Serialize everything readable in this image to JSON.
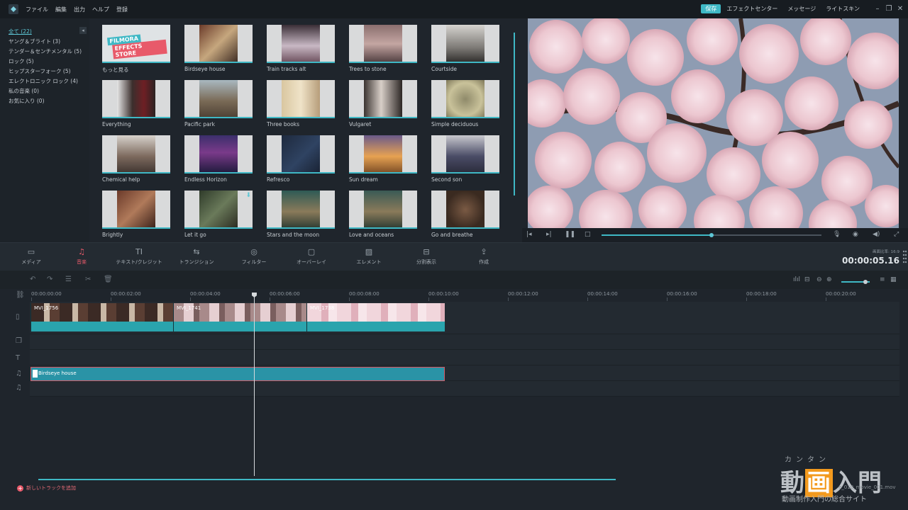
{
  "menubar": {
    "items": [
      "ファイル",
      "編集",
      "出力",
      "ヘルプ",
      "登録"
    ],
    "save_label": "保存",
    "links": [
      "エフェクトセンター",
      "メッセージ",
      "ライトスキン"
    ]
  },
  "sidebar": {
    "categories": [
      "全て (22)",
      "ヤング＆ブライト (3)",
      "テンダー＆センチメンタル (5)",
      "ロック (5)",
      "ヒップスターフォーク (5)",
      "エレクトロニック ロック (4)",
      "私の音楽 (0)",
      "お気に入り (0)"
    ]
  },
  "grid": {
    "store": {
      "line1": "FILMORA",
      "line2": "EFFECTS STORE",
      "label": "もっと見る"
    },
    "tiles": [
      "Birdseye house",
      "Train tracks alt",
      "Trees to stone",
      "Courtside",
      "Everything",
      "Pacific park",
      "Three books",
      "Vulgaret",
      "Simple deciduous",
      "Chemical help",
      "Endless Horizon",
      "Refresco",
      "Sun dream",
      "Second son",
      "Brightly",
      "Let it go",
      "Stars and the moon",
      "Love and oceans",
      "Go and breathe"
    ]
  },
  "preview": {
    "progress": 0.5
  },
  "tools": {
    "tabs": [
      "メディア",
      "音楽",
      "テキスト/クレジット",
      "トランジション",
      "フィルター",
      "オーバーレイ",
      "エレメント",
      "分割表示",
      "作成"
    ],
    "active_index": 1,
    "ratio_label": "画面比率: 16:9",
    "timecode": "00:00:05.16"
  },
  "timeline": {
    "ticks": [
      "00:00:00:00",
      "00:00:02:00",
      "00:00:04:00",
      "00:00:06:00",
      "00:00:08:00",
      "00:00:10:00",
      "00:00:12:00",
      "00:00:14:00",
      "00:00:16:00",
      "00:00:18:00",
      "00:00:20:00"
    ],
    "video_clips": [
      "MVI_1756",
      "MVI_1741",
      "MVI_1738"
    ],
    "audio_clip": "Birdseye house",
    "add_track": "新しいトラックを追加"
  },
  "watermark": {
    "ruby": "カンタン",
    "logo_a": "動",
    "logo_b": "画",
    "logo_c": "入門",
    "sub": "動画制作入門の総合サイト",
    "file": "e_010_movie_001.mov"
  }
}
